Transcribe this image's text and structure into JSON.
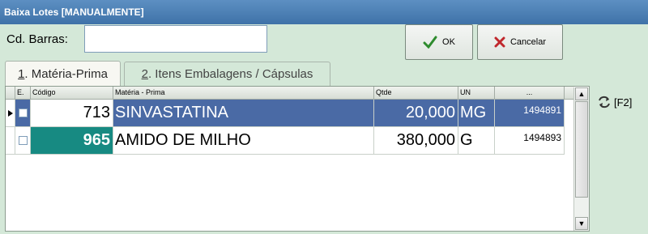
{
  "window": {
    "title": "Baixa Lotes [MANUALMENTE]"
  },
  "barras": {
    "label": "Cd. Barras:",
    "value": ""
  },
  "buttons": {
    "ok": "OK",
    "cancel": "Cancelar"
  },
  "tabs": [
    {
      "num": "1",
      "label": ". Matéria-Prima"
    },
    {
      "num": "2",
      "label": ". Itens Embalagens / Cápsulas"
    }
  ],
  "grid": {
    "columns": [
      "E.",
      "Código",
      "Matéria - Prima",
      "Qtde",
      "UN",
      "..."
    ],
    "rows": [
      {
        "codigo": "713",
        "materia": "SINVASTATINA",
        "qtde": "20,000",
        "un": "MG",
        "ref": "1494891"
      },
      {
        "codigo": "965",
        "materia": "AMIDO DE MILHO",
        "qtde": "380,000",
        "un": "G",
        "ref": "1494893"
      }
    ]
  },
  "side": {
    "f2": "[F2]"
  },
  "colors": {
    "title_bar": "#3f72a8",
    "selected_row": "#4a6aa5",
    "code_highlight": "#178a82",
    "window_bg": "#d4e8d8"
  }
}
